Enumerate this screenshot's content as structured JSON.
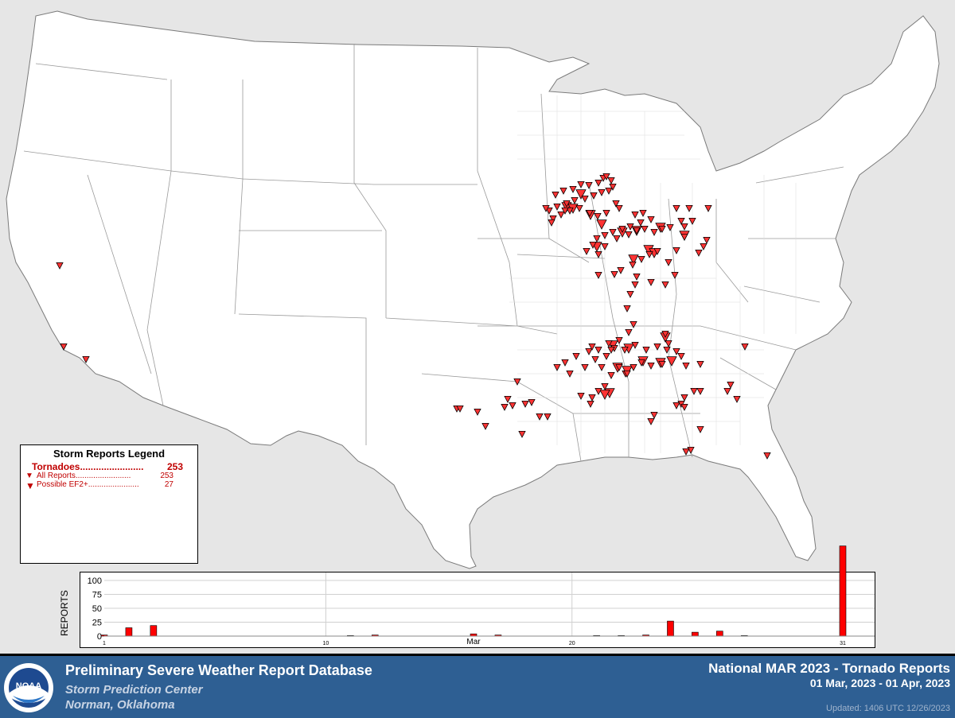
{
  "legend": {
    "title": "Storm Reports Legend",
    "tornadoes_label": "Tornadoes........................",
    "tornadoes_value": "253",
    "all_reports_label": "All Reports.........................",
    "all_reports_value": "253",
    "possible_label": "Possible EF2+.......................",
    "possible_value": "27"
  },
  "chart": {
    "ylabel": "REPORTS",
    "yticks": [
      "100",
      "75",
      "50",
      "25",
      "0"
    ],
    "xticks": [
      "1",
      "10",
      "20",
      "31"
    ],
    "month_label": "Mar",
    "bar_color": "#ff0000"
  },
  "chart_data": {
    "type": "bar",
    "title": "",
    "xlabel": "Mar",
    "ylabel": "REPORTS",
    "ylim": [
      0,
      100
    ],
    "categories": [
      1,
      2,
      3,
      4,
      5,
      6,
      7,
      8,
      9,
      10,
      11,
      12,
      13,
      14,
      15,
      16,
      17,
      18,
      19,
      20,
      21,
      22,
      23,
      24,
      25,
      26,
      27,
      28,
      29,
      30,
      31
    ],
    "values": [
      2,
      15,
      19,
      0,
      0,
      0,
      0,
      0,
      0,
      0,
      1,
      2,
      0,
      0,
      0,
      4,
      2,
      0,
      0,
      0,
      1,
      1,
      2,
      27,
      7,
      9,
      1,
      0,
      0,
      0,
      162
    ]
  },
  "map": {
    "background": "#ffffff",
    "report_color": "#ff3333",
    "reports": [
      [
        698,
        245
      ],
      [
        708,
        240
      ],
      [
        720,
        238
      ],
      [
        730,
        232
      ],
      [
        740,
        233
      ],
      [
        752,
        230
      ],
      [
        758,
        224
      ],
      [
        762,
        222
      ],
      [
        768,
        227
      ],
      [
        770,
        235
      ],
      [
        765,
        240
      ],
      [
        756,
        242
      ],
      [
        746,
        246
      ],
      [
        735,
        250
      ],
      [
        722,
        252
      ],
      [
        712,
        256
      ],
      [
        700,
        260
      ],
      [
        690,
        265
      ],
      [
        695,
        275
      ],
      [
        705,
        270
      ],
      [
        716,
        265
      ],
      [
        728,
        262
      ],
      [
        741,
        268
      ],
      [
        751,
        272
      ],
      [
        762,
        268
      ],
      [
        774,
        256
      ],
      [
        778,
        262
      ],
      [
        686,
        262
      ],
      [
        693,
        280
      ],
      [
        710,
        265
      ],
      [
        808,
        268
      ],
      [
        818,
        276
      ],
      [
        805,
        280
      ],
      [
        792,
        285
      ],
      [
        782,
        288
      ],
      [
        770,
        292
      ],
      [
        760,
        296
      ],
      [
        750,
        300
      ],
      [
        745,
        308
      ],
      [
        737,
        316
      ],
      [
        752,
        320
      ],
      [
        760,
        310
      ],
      [
        775,
        300
      ],
      [
        790,
        295
      ],
      [
        800,
        290
      ],
      [
        810,
        288
      ],
      [
        822,
        292
      ],
      [
        832,
        288
      ],
      [
        842,
        286
      ],
      [
        850,
        262
      ],
      [
        860,
        285
      ],
      [
        870,
        278
      ],
      [
        860,
        298
      ],
      [
        850,
        315
      ],
      [
        840,
        330
      ],
      [
        826,
        316
      ],
      [
        816,
        320
      ],
      [
        806,
        326
      ],
      [
        795,
        333
      ],
      [
        780,
        340
      ],
      [
        772,
        345
      ],
      [
        800,
        348
      ],
      [
        798,
        358
      ],
      [
        792,
        370
      ],
      [
        788,
        388
      ],
      [
        796,
        408
      ],
      [
        818,
        355
      ],
      [
        836,
        358
      ],
      [
        848,
        346
      ],
      [
        884,
        310
      ],
      [
        878,
        318
      ],
      [
        890,
        262
      ],
      [
        866,
        262
      ],
      [
        856,
        278
      ],
      [
        752,
        346
      ],
      [
        888,
        302
      ],
      [
        798,
        270
      ],
      [
        790,
        418
      ],
      [
        778,
        428
      ],
      [
        765,
        432
      ],
      [
        752,
        440
      ],
      [
        740,
        442
      ],
      [
        724,
        448
      ],
      [
        710,
        456
      ],
      [
        700,
        462
      ],
      [
        735,
        462
      ],
      [
        748,
        452
      ],
      [
        762,
        448
      ],
      [
        772,
        438
      ],
      [
        785,
        440
      ],
      [
        798,
        434
      ],
      [
        812,
        440
      ],
      [
        826,
        436
      ],
      [
        838,
        440
      ],
      [
        850,
        442
      ],
      [
        836,
        420
      ],
      [
        840,
        432
      ],
      [
        832,
        458
      ],
      [
        818,
        460
      ],
      [
        806,
        456
      ],
      [
        796,
        462
      ],
      [
        786,
        470
      ],
      [
        778,
        462
      ],
      [
        768,
        472
      ],
      [
        760,
        486
      ],
      [
        752,
        492
      ],
      [
        742,
        508
      ],
      [
        744,
        500
      ],
      [
        716,
        470
      ],
      [
        730,
        498
      ],
      [
        756,
        462
      ],
      [
        744,
        436
      ],
      [
        768,
        440
      ],
      [
        788,
        470
      ],
      [
        862,
        460
      ],
      [
        880,
        458
      ],
      [
        856,
        448
      ],
      [
        936,
        436
      ],
      [
        918,
        484
      ],
      [
        914,
        492
      ],
      [
        926,
        502
      ],
      [
        880,
        492
      ],
      [
        872,
        492
      ],
      [
        860,
        500
      ],
      [
        856,
        508
      ],
      [
        860,
        512
      ],
      [
        850,
        510
      ],
      [
        822,
        522
      ],
      [
        818,
        530
      ],
      [
        880,
        540
      ],
      [
        868,
        566
      ],
      [
        862,
        568
      ],
      [
        964,
        573
      ],
      [
        656,
        546
      ],
      [
        610,
        536
      ],
      [
        638,
        502
      ],
      [
        644,
        510
      ],
      [
        634,
        512
      ],
      [
        660,
        508
      ],
      [
        668,
        506
      ],
      [
        650,
        480
      ],
      [
        678,
        524
      ],
      [
        688,
        524
      ],
      [
        600,
        518
      ],
      [
        574,
        514
      ],
      [
        578,
        514
      ],
      [
        75,
        334
      ],
      [
        80,
        436
      ],
      [
        108,
        452
      ]
    ],
    "ef2": [
      [
        730,
        244
      ],
      [
        712,
        260
      ],
      [
        720,
        262
      ],
      [
        742,
        270
      ],
      [
        756,
        282
      ],
      [
        815,
        314
      ],
      [
        822,
        318
      ],
      [
        830,
        286
      ],
      [
        800,
        290
      ],
      [
        782,
        292
      ],
      [
        860,
        296
      ],
      [
        770,
        434
      ],
      [
        790,
        438
      ],
      [
        808,
        454
      ],
      [
        830,
        456
      ],
      [
        844,
        454
      ],
      [
        766,
        494
      ],
      [
        760,
        496
      ],
      [
        836,
        424
      ],
      [
        776,
        462
      ],
      [
        788,
        466
      ],
      [
        750,
        310
      ],
      [
        796,
        326
      ]
    ]
  },
  "footer": {
    "title": "Preliminary Severe Weather Report Database",
    "org": "Storm Prediction Center",
    "location": "Norman, Oklahoma",
    "right_title": "National MAR 2023 - Tornado Reports",
    "date_range": "01 Mar, 2023 - 01 Apr, 2023",
    "updated": "Updated: 1406 UTC 12/26/2023",
    "logo_text": "NOAA"
  }
}
